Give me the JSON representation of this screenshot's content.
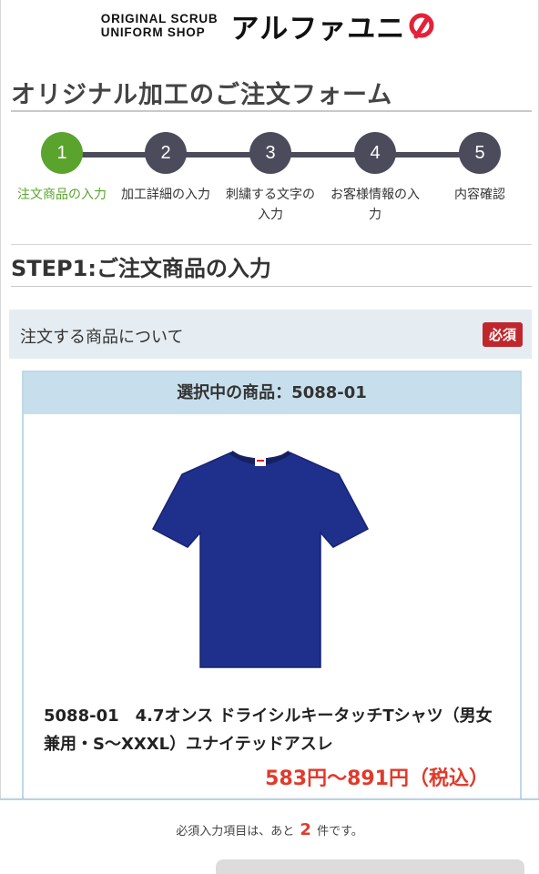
{
  "header": {
    "logo_en_line1": "ORIGINAL SCRUB",
    "logo_en_line2": "UNIFORM SHOP",
    "logo_jp": "アルファユニ",
    "logo_mark_icon": "alpha-uni-mark-icon",
    "brand_color": "#e5213a"
  },
  "page_title": "オリジナル加工のご注文フォーム",
  "steps": [
    {
      "number": "1",
      "label": "注文商品の入力",
      "active": true
    },
    {
      "number": "2",
      "label": "加工詳細の入力",
      "active": false
    },
    {
      "number": "3",
      "label": "刺繍する文字の入力",
      "active": false
    },
    {
      "number": "4",
      "label": "お客様情報の入力",
      "active": false
    },
    {
      "number": "5",
      "label": "内容確認",
      "active": false
    }
  ],
  "colors": {
    "active_step": "#5aa42e",
    "inactive_step": "#4b4b5b",
    "required": "#c0272d",
    "price": "#e03a2b"
  },
  "step_heading": "STEP1:ご注文商品の入力",
  "section": {
    "title": "注文する商品について",
    "required_label": "必須"
  },
  "product": {
    "header": "選択中の商品：5088-01",
    "image_icon": "tshirt-navy-icon",
    "name": "5088-01　4.7オンス ドライシルキータッチTシャツ（男女兼用・S〜XXXL）ユナイテッドアスレ",
    "price": "583円〜891円（税込）"
  },
  "footer": {
    "remaining_prefix": "必須入力項目は、あと",
    "remaining_count": "2",
    "remaining_suffix": "件です。"
  }
}
